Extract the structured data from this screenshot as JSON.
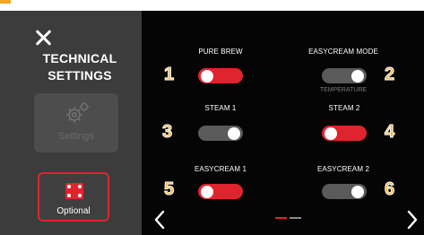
{
  "sidebar": {
    "title_line1": "TECHNICAL",
    "title_line2": "SETTINGS",
    "settings_label": "Settings",
    "optional_label": "Optional"
  },
  "icons": {
    "close": "close-icon",
    "gear": "gear-icon",
    "optional": "optional-icon",
    "prev": "chevron-left-icon",
    "next": "chevron-right-icon"
  },
  "items": [
    {
      "badge": "1",
      "label": "PURE BREW",
      "state": "on"
    },
    {
      "badge": "2",
      "label": "EASYCREAM MODE",
      "sublabel": "TEMPERATURE",
      "state": "off"
    },
    {
      "badge": "3",
      "label": "STEAM 1",
      "state": "off"
    },
    {
      "badge": "4",
      "label": "STEAM 2",
      "state": "on"
    },
    {
      "badge": "5",
      "label": "EASYCREAM 1",
      "state": "on"
    },
    {
      "badge": "6",
      "label": "EASYCREAM 2",
      "state": "off"
    }
  ],
  "pagination": {
    "current": 1,
    "total": 2
  },
  "colors": {
    "accent": "#e0242f",
    "badge": "#f3b43a",
    "sidebar_bg": "#3c3c3c",
    "screen_bg": "#050505",
    "toggle_off": "#5a5a5a"
  }
}
